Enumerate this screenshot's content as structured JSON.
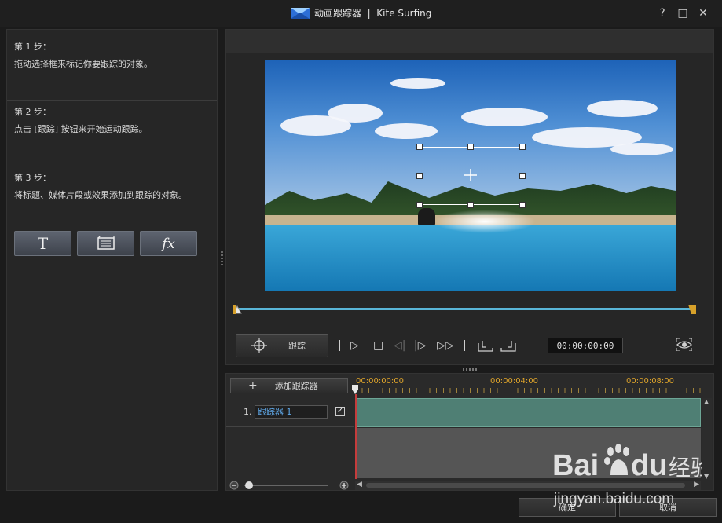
{
  "window": {
    "title": "动画跟踪器  |  Kite Surfing",
    "help": "?",
    "maximize": "□",
    "close": "✕"
  },
  "steps": [
    {
      "title": "第 1 步：",
      "desc": "拖动选择框来标记你要跟踪的对象。"
    },
    {
      "title": "第 2 步：",
      "desc": "点击 [跟踪] 按钮来开始运动跟踪。"
    },
    {
      "title": "第 3 步：",
      "desc": "将标题、媒体片段或效果添加到跟踪的对象。"
    }
  ],
  "tools": {
    "title_glyph": "T",
    "fx_glyph": "fx",
    "icons": [
      "title-icon",
      "media-clip-icon",
      "fx-icon"
    ]
  },
  "controls": {
    "track_label": "跟踪",
    "timecode": "00:00:00:00",
    "icons": [
      "play-icon",
      "stop-icon",
      "previous-frame-icon",
      "next-frame-icon",
      "fast-forward-icon",
      "mark-in-icon",
      "mark-out-icon",
      "preview-eye-icon"
    ]
  },
  "tracker": {
    "add_label": "添加跟踪器",
    "ruler": [
      "00:00:00:00",
      "00:00:04:00",
      "00:00:08:00"
    ],
    "rows": [
      {
        "num": "1.",
        "name": "跟踪器 1",
        "checked": true
      }
    ]
  },
  "footer": {
    "ok": "确定",
    "cancel": "取消"
  },
  "colors": {
    "timeline_accent": "#5ab6d8",
    "clip_fill": "#4f7f74",
    "ruler_text": "#e0a52a",
    "tracker_name": "#5fa7e6",
    "playhead": "#c53c3c"
  }
}
